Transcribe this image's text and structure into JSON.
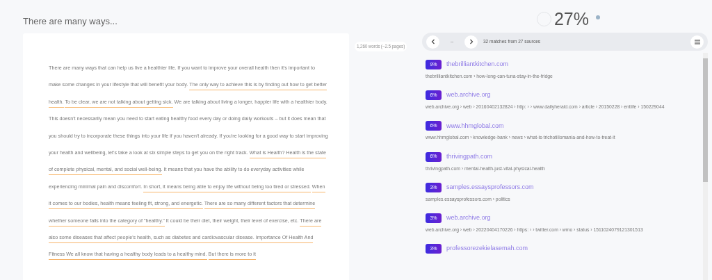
{
  "document": {
    "title": "There are many ways...",
    "word_count": "1,260 words (~2.5 pages)",
    "segments": [
      {
        "text": "There are many ways that can help us live a healthier life. If you want to improve your overall health then it's important to make some changes in your lifestyle that will benefit your body.",
        "matched": false
      },
      {
        "text": "The only way to achieve this is by finding out how to get better health.",
        "matched": true
      },
      {
        "text": "To be clear, we are not talking about getting sick.",
        "matched": true
      },
      {
        "text": "We are talking about living a longer, happier life with a healthier body. This doesn't necessarily mean you need to start eating healthy food every day or doing daily workouts – but it does mean that you should try to incorporate these things into your life if you haven't already. If you're looking for a good way to start improving your health and wellbeing, let's take a look at six simple steps to get you on the right track.",
        "matched": false
      },
      {
        "text": "What is Health? Health is the state of complete physical, mental, and social well-being.",
        "matched": true
      },
      {
        "text": "It means that you have the ability to do everyday activities while experiencing minimal pain and discomfort.",
        "matched": false
      },
      {
        "text": "In short, it means being able to enjoy life without being too tired or stressed.",
        "matched": true
      },
      {
        "text": "When it comes to our bodies, health means feeling fit, strong, and energetic.",
        "matched": true
      },
      {
        "text": "There are so many different factors that determine whether someone falls into the category of \"healthy.\"",
        "matched": true
      },
      {
        "text": "It could be their diet, their weight, their level of exercise, etc.",
        "matched": false
      },
      {
        "text": "There are also some diseases that affect people's health, such as diabetes and cardiovascular disease. Importance Of Health And Fitness We all know that having a healthy body leads to a healthy mind.",
        "matched": true
      },
      {
        "text": "But there is more to it",
        "matched": true
      }
    ]
  },
  "results": {
    "score": "27%",
    "position": "--",
    "summary": "32 matches from 27 sources",
    "sources": [
      {
        "percent": "9%",
        "domain": "thebrilliantkitchen.com",
        "path": "thebrilliantkitchen.com › how-long-can-tuna-stay-in-the-fridge"
      },
      {
        "percent": "6%",
        "domain": "web.archive.org",
        "path": "web.archive.org › web › 20160402132824 › http: ›  › www.dailyherald.com › article › 20150228 › entlife › 150229044"
      },
      {
        "percent": "6%",
        "domain": "www.hhmglobal.com",
        "path": "www.hhmglobal.com › knowledge-bank › news › what-is-trichotillomania-and-how-to-treat-it"
      },
      {
        "percent": "6%",
        "domain": "thrivingpath.com",
        "path": "thrivingpath.com › mental-health-just-vital-physical-health"
      },
      {
        "percent": "3%",
        "domain": "samples.essaysprofessors.com",
        "path": "samples.essaysprofessors.com › politics"
      },
      {
        "percent": "3%",
        "domain": "web.archive.org",
        "path": "web.archive.org › web › 20220404170226 › https: ›  › twitter.com › wmo › status › 1511024079121301513"
      },
      {
        "percent": "3%",
        "domain": "professorezekielasemah.com"
      }
    ]
  }
}
